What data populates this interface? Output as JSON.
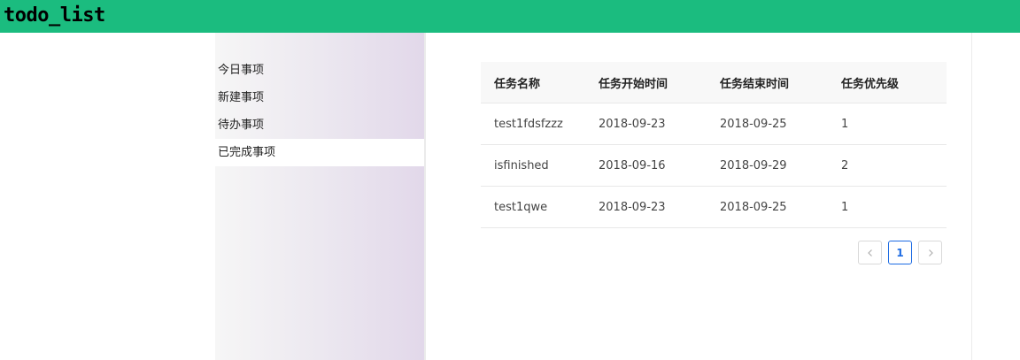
{
  "app": {
    "title": "todo_list",
    "accent_color": "#1bbc7f"
  },
  "sidebar": {
    "items": [
      {
        "label": "今日事项",
        "active": false
      },
      {
        "label": "新建事项",
        "active": false
      },
      {
        "label": "待办事项",
        "active": false
      },
      {
        "label": "已完成事项",
        "active": true
      }
    ]
  },
  "table": {
    "headers": [
      "任务名称",
      "任务开始时间",
      "任务结束时间",
      "任务优先级"
    ],
    "rows": [
      [
        "test1fdsfzzz",
        "2018-09-23",
        "2018-09-25",
        "1"
      ],
      [
        "isfinished",
        "2018-09-16",
        "2018-09-29",
        "2"
      ],
      [
        "test1qwe",
        "2018-09-23",
        "2018-09-25",
        "1"
      ]
    ]
  },
  "pagination": {
    "prev_icon": "chevron-left-icon",
    "next_icon": "chevron-right-icon",
    "current_page": "1",
    "active_color": "#1d6be3"
  }
}
